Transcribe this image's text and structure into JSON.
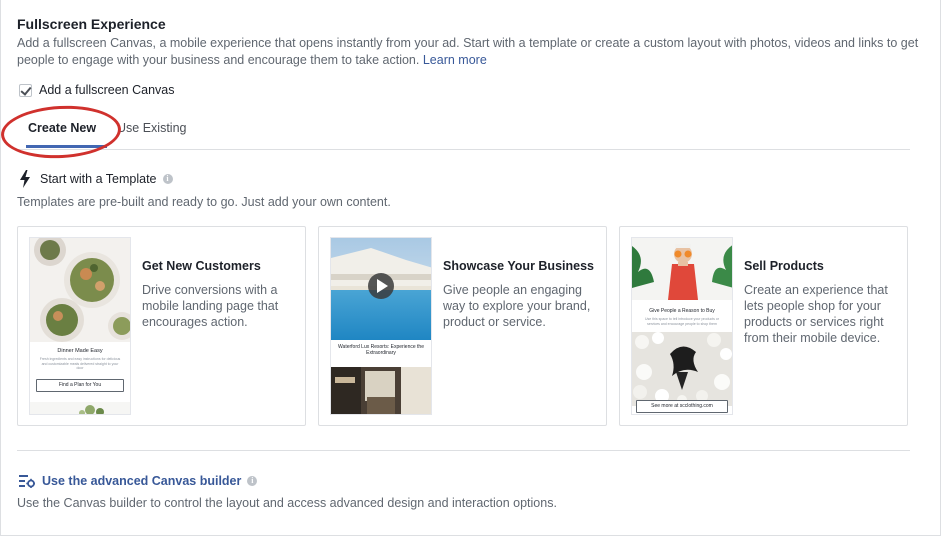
{
  "section": {
    "title": "Fullscreen Experience",
    "description": "Add a fullscreen Canvas, a mobile experience that opens instantly from your ad. Start with a template or create a custom layout with photos, videos and links to get people to engage with your business and encourage them to take action.",
    "learn_more": "Learn more"
  },
  "checkbox": {
    "label": "Add a fullscreen Canvas",
    "checked": true
  },
  "tabs": [
    {
      "label": "Create New",
      "active": true
    },
    {
      "label": "Use Existing",
      "active": false
    }
  ],
  "template": {
    "heading": "Start with a Template",
    "description": "Templates are pre-built and ready to go. Just add your own content.",
    "cards": [
      {
        "title": "Get New Customers",
        "description": "Drive conversions with a mobile landing page that encourages action.",
        "thumb_heading": "Dinner Made Easy",
        "thumb_text": "Fresh ingredients and easy instructions for delicious and customizable meals delivered straight to your door",
        "thumb_button": "Find a Plan for You"
      },
      {
        "title": "Showcase Your Business",
        "description": "Give people an engaging way to explore your brand, product or service.",
        "thumb_heading": "Waterford Lux Resorts: Experience the Extraordinary"
      },
      {
        "title": "Sell Products",
        "description": "Create an experience that lets people shop for your products or services right from their mobile device.",
        "thumb_heading": "Give People a Reason to Buy",
        "thumb_text": "Use this space to tell introduce your products or services and encourage people to shop them",
        "thumb_button": "See more at scclothing.com"
      }
    ]
  },
  "advanced": {
    "label": "Use the advanced Canvas builder",
    "description": "Use the Canvas builder to control the layout and access advanced design and interaction options."
  },
  "colors": {
    "link": "#385898",
    "accent": "#4267b2",
    "annotation": "#d0312d"
  }
}
